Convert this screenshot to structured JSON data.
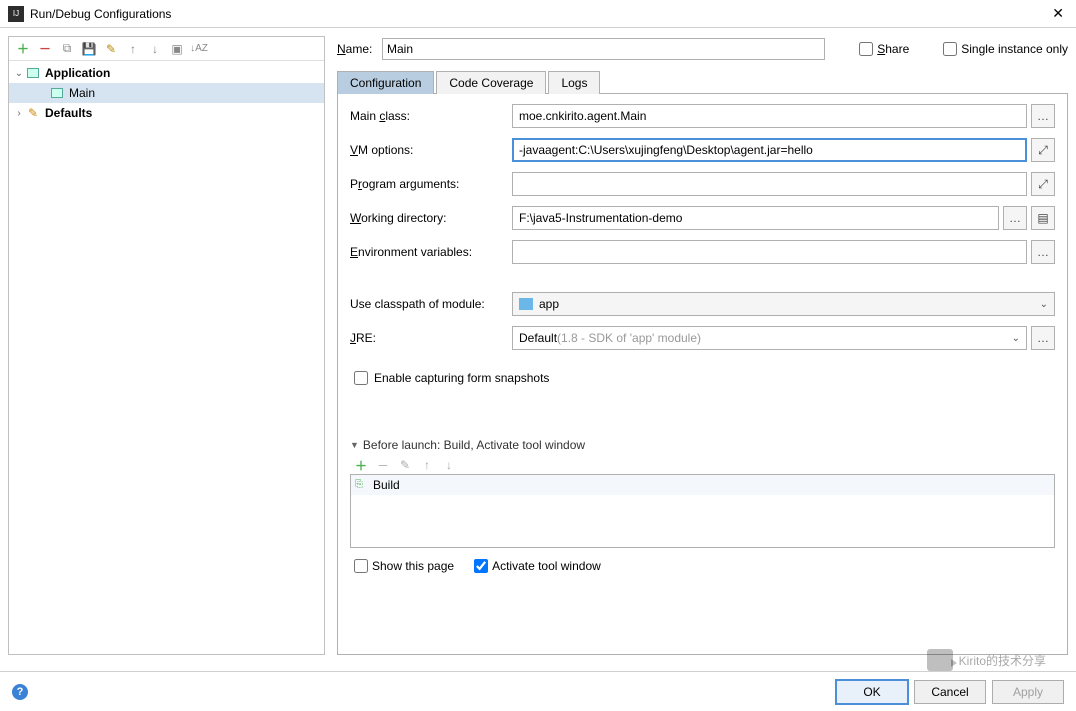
{
  "window": {
    "title": "Run/Debug Configurations"
  },
  "tree": {
    "application": "Application",
    "main": "Main",
    "defaults": "Defaults"
  },
  "nameRow": {
    "label": "Name:",
    "value": "Main",
    "share": "Share",
    "singleInstance": "Single instance only"
  },
  "tabs": {
    "configuration": "Configuration",
    "codeCoverage": "Code Coverage",
    "logs": "Logs"
  },
  "form": {
    "mainClassLabel": "Main class:",
    "mainClassValue": "moe.cnkirito.agent.Main",
    "vmLabel": "VM options:",
    "vmValue": "-javaagent:C:\\Users\\xujingfeng\\Desktop\\agent.jar=hello",
    "progArgsLabel": "Program arguments:",
    "progArgsValue": "",
    "workDirLabel": "Working directory:",
    "workDirValue": "F:\\java5-Instrumentation-demo",
    "envLabel": "Environment variables:",
    "envValue": "",
    "classpathLabel": "Use classpath of module:",
    "classpathValue": "app",
    "jreLabel": "JRE:",
    "jreValue": "Default ",
    "jreHint": "(1.8 - SDK of 'app' module)",
    "enableSnapshots": "Enable capturing form snapshots"
  },
  "beforeLaunch": {
    "title": "Before launch: Build, Activate tool window",
    "item": "Build",
    "showThisPage": "Show this page",
    "activateToolWindow": "Activate tool window"
  },
  "buttons": {
    "ok": "OK",
    "cancel": "Cancel",
    "apply": "Apply"
  },
  "watermark": "Kirito的技术分享"
}
